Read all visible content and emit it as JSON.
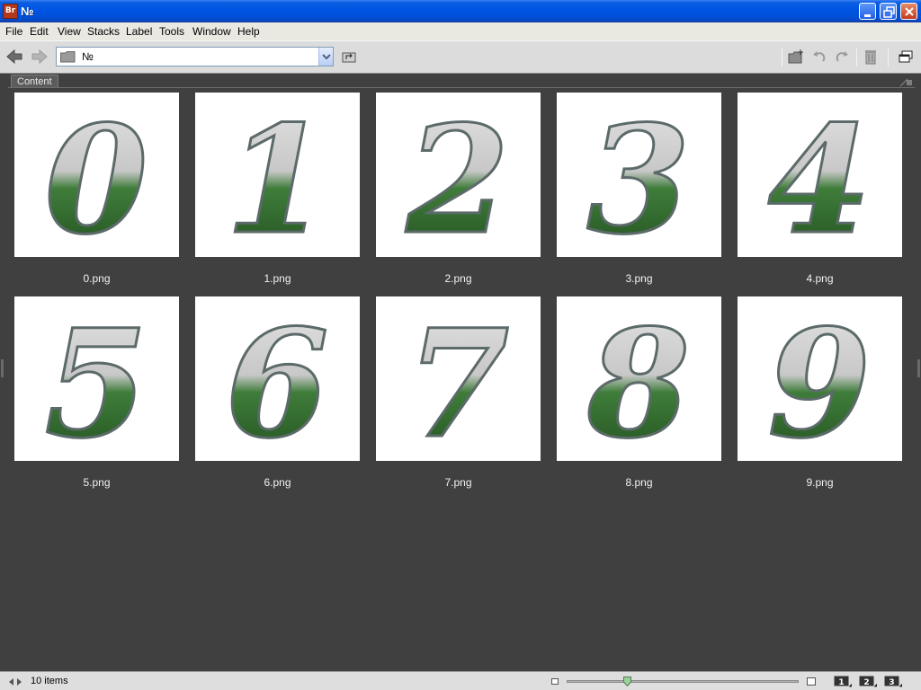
{
  "window": {
    "title": "№",
    "app_logo": "Br"
  },
  "menu": {
    "items": [
      "File",
      "Edit",
      "View",
      "Stacks",
      "Label",
      "Tools",
      "Window",
      "Help"
    ]
  },
  "toolbar": {
    "path": "№"
  },
  "panel": {
    "tab_label": "Content"
  },
  "thumbnails": [
    {
      "glyph": "0",
      "label": "0.png"
    },
    {
      "glyph": "1",
      "label": "1.png"
    },
    {
      "glyph": "2",
      "label": "2.png"
    },
    {
      "glyph": "3",
      "label": "3.png"
    },
    {
      "glyph": "4",
      "label": "4.png"
    },
    {
      "glyph": "5",
      "label": "5.png"
    },
    {
      "glyph": "6",
      "label": "6.png"
    },
    {
      "glyph": "7",
      "label": "7.png"
    },
    {
      "glyph": "8",
      "label": "8.png"
    },
    {
      "glyph": "9",
      "label": "9.png"
    }
  ],
  "status": {
    "items_count": "10 items",
    "view_buttons": [
      "1",
      "2",
      "3"
    ]
  },
  "colors": {
    "panel_bg": "#404040",
    "titlebar_blue": "#0054e3",
    "menu_bg": "#e9e8e1",
    "toolbar_bg": "#dcdcdc"
  }
}
